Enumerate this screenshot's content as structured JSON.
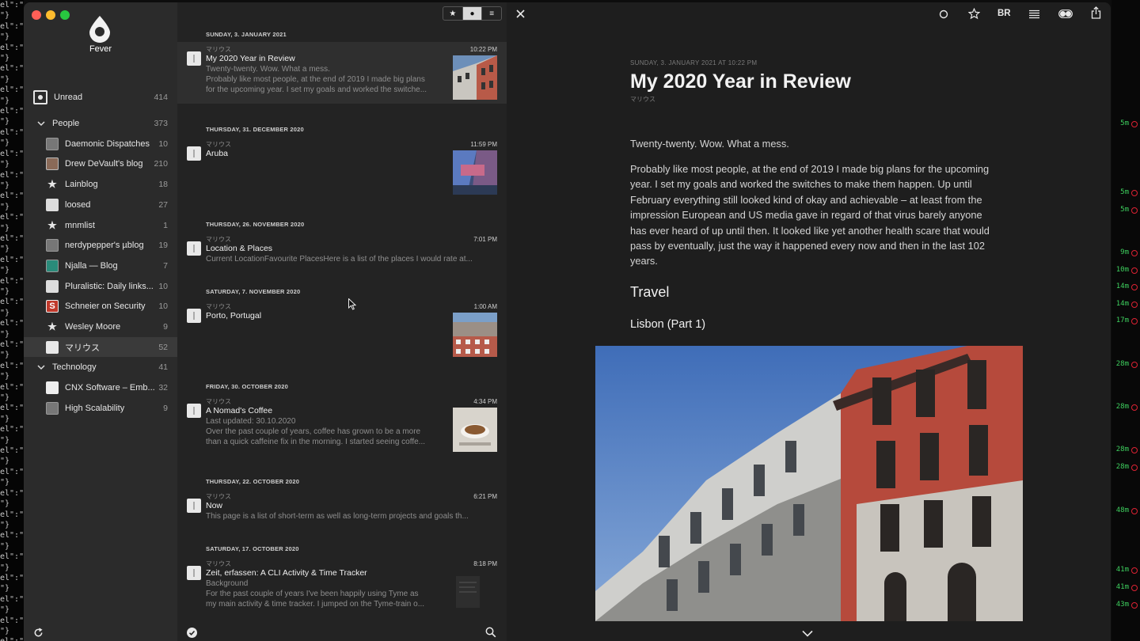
{
  "app": {
    "name": "Fever"
  },
  "sidebar": {
    "unread": {
      "label": "Unread",
      "count": "414"
    },
    "groups": [
      {
        "label": "People",
        "count": "373",
        "feeds": [
          {
            "label": "Daemonic Dispatches",
            "count": "10",
            "icon": "box-icon"
          },
          {
            "label": "Drew DeVault's blog",
            "count": "210",
            "icon": "photo-icon"
          },
          {
            "label": "Lainblog",
            "count": "18",
            "icon": "star-icon"
          },
          {
            "label": "loosed",
            "count": "27",
            "icon": "bottle-icon"
          },
          {
            "label": "mnmlist",
            "count": "1",
            "icon": "star-icon"
          },
          {
            "label": "nerdypepper's µblog",
            "count": "19",
            "icon": "box-icon"
          },
          {
            "label": "Njalla — Blog",
            "count": "7",
            "icon": "teal-box-icon"
          },
          {
            "label": "Pluralistic: Daily links...",
            "count": "10",
            "icon": "bottle-icon"
          },
          {
            "label": "Schneier on Security",
            "count": "10",
            "icon": "s-icon"
          },
          {
            "label": "Wesley Moore",
            "count": "9",
            "icon": "star-icon"
          },
          {
            "label": "マリウス",
            "count": "52",
            "icon": "page-icon"
          }
        ]
      },
      {
        "label": "Technology",
        "count": "41",
        "feeds": [
          {
            "label": "CNX Software – Emb...",
            "count": "32",
            "icon": "cnx-icon"
          },
          {
            "label": "High Scalability",
            "count": "9",
            "icon": "box-icon"
          }
        ]
      }
    ]
  },
  "toolbar": {
    "segments": [
      "★",
      "●",
      "≡"
    ],
    "close": "✕",
    "right_icons": [
      "circle-icon",
      "star-icon",
      "BR",
      "list-icon",
      "toggle-icon",
      "share-icon"
    ],
    "br_label": "BR"
  },
  "list": {
    "groups": [
      {
        "date": "SUNDAY, 3. JANUARY 2021",
        "items": [
          {
            "source": "マリウス",
            "time": "10:22 PM",
            "title": "My 2020 Year in Review",
            "excerpt": [
              "Twenty-twenty. Wow. What a mess.",
              "Probably like most people, at the end of 2019 I made big plans",
              "for the upcoming year. I set my goals and worked the switche..."
            ],
            "thumb": "street"
          }
        ]
      },
      {
        "date": "THURSDAY, 31. DECEMBER 2020",
        "items": [
          {
            "source": "マリウス",
            "time": "11:59 PM",
            "title": "Aruba",
            "excerpt": [],
            "thumb": "mural"
          }
        ]
      },
      {
        "date": "THURSDAY, 26. NOVEMBER 2020",
        "items": [
          {
            "source": "マリウス",
            "time": "7:01 PM",
            "title": "Location & Places",
            "excerpt": [
              "Current LocationFavourite PlacesHere is a list of the places I would rate at..."
            ],
            "thumb": ""
          }
        ]
      },
      {
        "date": "SATURDAY, 7. NOVEMBER 2020",
        "items": [
          {
            "source": "マリウス",
            "time": "1:00 AM",
            "title": "Porto, Portugal",
            "excerpt": [],
            "thumb": "porto"
          }
        ]
      },
      {
        "date": "FRIDAY, 30. OCTOBER 2020",
        "items": [
          {
            "source": "マリウス",
            "time": "4:34 PM",
            "title": "A Nomad's Coffee",
            "excerpt": [
              "Last updated: 30.10.2020",
              "Over the past couple of years, coffee has grown to be a more",
              "than a quick caffeine fix in the morning. I started seeing coffe..."
            ],
            "thumb": "coffee"
          }
        ]
      },
      {
        "date": "THURSDAY, 22. OCTOBER 2020",
        "items": [
          {
            "source": "マリウス",
            "time": "6:21 PM",
            "title": "Now",
            "excerpt": [
              "This page is a list of short-term as well as long-term projects and goals th..."
            ],
            "thumb": ""
          }
        ]
      },
      {
        "date": "SATURDAY, 17. OCTOBER 2020",
        "items": [
          {
            "source": "マリウス",
            "time": "8:18 PM",
            "title": "Zeit, erfassen: A CLI Activity & Time Tracker",
            "excerpt": [
              "Background",
              "For the past couple of years I've been happily using Tyme as",
              "my main activity & time tracker. I jumped on the Tyme-train o..."
            ],
            "thumb": "laptop"
          }
        ]
      }
    ]
  },
  "article": {
    "meta": "SUNDAY, 3. JANUARY 2021 AT 10:22 PM",
    "title": "My 2020 Year in Review",
    "author": "マリウス",
    "paragraphs": [
      "Twenty-twenty. Wow. What a mess.",
      "Probably like most people, at the end of 2019 I made big plans for the upcoming year. I set my goals and worked the switches to make them happen. Up until February everything still looked kind of okay and achievable – at least from the impression European and US media gave in regard of that virus barely anyone has ever heard of up until then. It looked like yet another health scare that would pass by eventually, just the way it happened every now and then in the last 102 years."
    ],
    "h2": "Travel",
    "h3": "Lisbon (Part 1)"
  },
  "terminal_right": [
    "5m",
    "5m",
    "5m",
    "9m",
    "10m",
    "14m",
    "14m",
    "17m",
    "28m",
    "28m",
    "28m",
    "28m",
    "48m",
    "41m",
    "41m",
    "43m"
  ],
  "colors": {
    "accent_red": "#ff5f57",
    "accent_yellow": "#febc2e",
    "accent_green": "#28c840",
    "terminal_green": "#3ecf5e"
  }
}
